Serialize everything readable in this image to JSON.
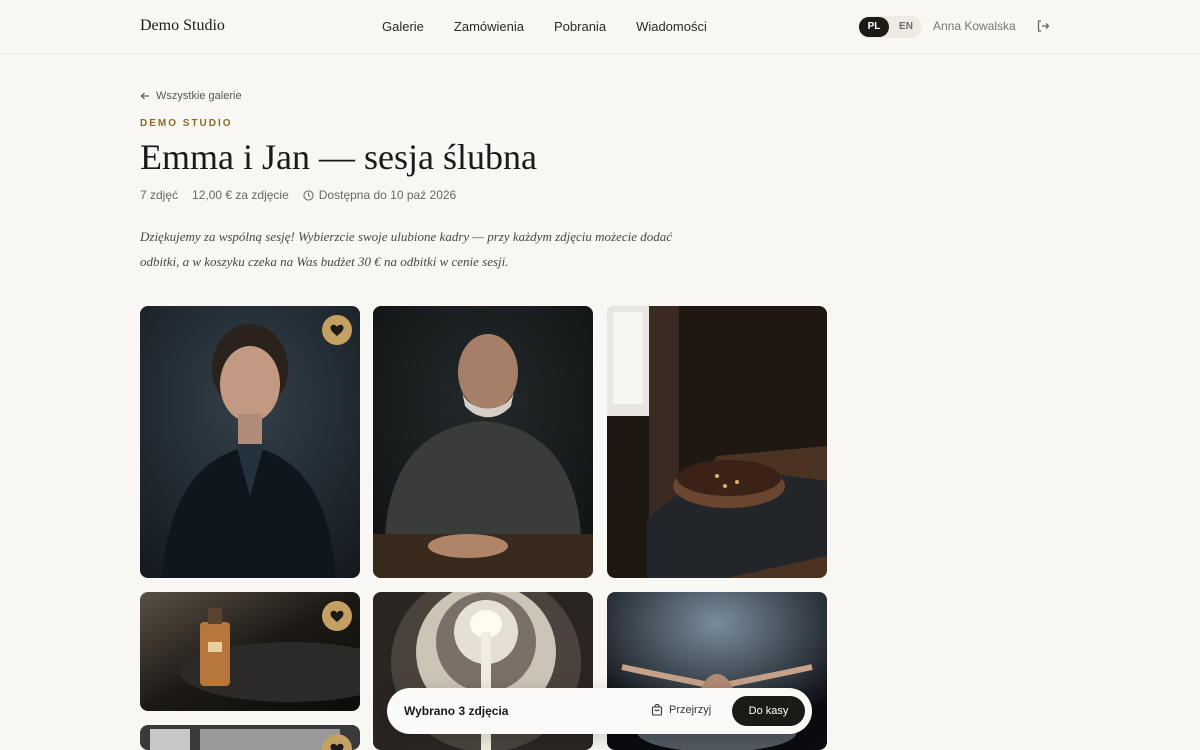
{
  "header": {
    "brand": "Demo Studio",
    "nav": [
      "Galerie",
      "Zamówienia",
      "Pobrania",
      "Wiadomości"
    ],
    "lang": {
      "active": "PL",
      "other": "EN"
    },
    "user": "Anna Kowalska"
  },
  "gallery": {
    "back": "Wszystkie galerie",
    "studio": "DEMO STUDIO",
    "title": "Emma i Jan — sesja ślubna",
    "photo_count": "7 zdjęć",
    "price": "12,00 € za zdjęcie",
    "availability": "Dostępna do 10 paź 2026",
    "description": "Dziękujemy za wspólną sesję! Wybierzcie swoje ulubione kadry — przy każdym zdjęciu możecie dodać odbitki, a w koszyku czeka na Was budżet 30 € na odbitki w cenie sesji."
  },
  "photos": [
    {
      "subject": "woman-portrait",
      "favorite": true
    },
    {
      "subject": "old-man-portrait",
      "favorite": false
    },
    {
      "subject": "chocolate-tart",
      "favorite": false
    },
    {
      "subject": "perfume-bottle",
      "favorite": true
    },
    {
      "subject": "spiral-staircase",
      "favorite": false
    },
    {
      "subject": "dancer-splash",
      "favorite": false
    },
    {
      "subject": "industrial-window",
      "favorite": true
    }
  ],
  "selection": {
    "count_text": "Wybrano 3 zdjęcia",
    "preview": "Przejrzyj",
    "checkout": "Do kasy"
  },
  "colors": {
    "accent": "#c4a062",
    "eyebrow": "#8a6a2e",
    "dark": "#1c1a17",
    "background": "#f9f7f3"
  }
}
